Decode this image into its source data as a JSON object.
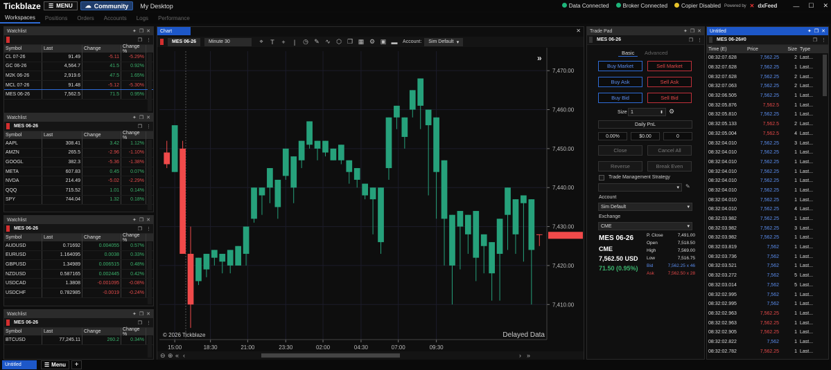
{
  "topbar": {
    "logo": "Tickblaze",
    "menu": "MENU",
    "community": "Community",
    "desktop": "My Desktop",
    "status": [
      {
        "label": "Data Connected",
        "color": "#1db57a"
      },
      {
        "label": "Broker Connected",
        "color": "#1db57a"
      },
      {
        "label": "Copier Disabled",
        "color": "#e6c229"
      }
    ],
    "powered_by": "Powered by",
    "feed": "dxFeed"
  },
  "workspace_tabs": [
    "Workspaces",
    "Positions",
    "Orders",
    "Accounts",
    "Logs",
    "Performance"
  ],
  "watchlists": [
    {
      "title": "Watchlist",
      "symbol": "",
      "headers": [
        "Symbol",
        "Last",
        "Change",
        "Change %"
      ],
      "rows": [
        [
          "CL 07-26",
          "91.49",
          "-5.11",
          "-5.29%"
        ],
        [
          "GC 06-26",
          "4,564.7",
          "41.5",
          "0.92%"
        ],
        [
          "M2K 06-26",
          "2,919.6",
          "47.5",
          "1.65%"
        ],
        [
          "MCL 07-26",
          "91.48",
          "-5.12",
          "-5.30%"
        ],
        [
          "MES 06-26",
          "7,562.5",
          "71.5",
          "0.95%"
        ]
      ]
    },
    {
      "title": "Watchlist",
      "symbol": "MES 06-26",
      "headers": [
        "Symbol",
        "Last",
        "Change",
        "Change %"
      ],
      "rows": [
        [
          "AAPL",
          "308.41",
          "3.42",
          "1.12%"
        ],
        [
          "AMZN",
          "265.5",
          "-2.96",
          "-1.10%"
        ],
        [
          "GOOGL",
          "382.3",
          "-5.36",
          "-1.38%"
        ],
        [
          "META",
          "607.83",
          "0.45",
          "0.07%"
        ],
        [
          "NVDA",
          "214.49",
          "-5.02",
          "-2.29%"
        ],
        [
          "QQQ",
          "715.52",
          "1.01",
          "0.14%"
        ],
        [
          "SPY",
          "744.04",
          "1.32",
          "0.18%"
        ]
      ]
    },
    {
      "title": "Watchlist",
      "symbol": "MES 06-26",
      "headers": [
        "Symbol",
        "Last",
        "Change",
        "Change %"
      ],
      "rows": [
        [
          "AUDUSD",
          "0.71692",
          "0.004055",
          "0.57%"
        ],
        [
          "EURUSD",
          "1.164095",
          "0.0038",
          "0.33%"
        ],
        [
          "GBPUSD",
          "1.34989",
          "0.006515",
          "0.48%"
        ],
        [
          "NZDUSD",
          "0.587165",
          "0.002445",
          "0.42%"
        ],
        [
          "USDCAD",
          "1.3808",
          "-0.001095",
          "-0.08%"
        ],
        [
          "USDCHF",
          "0.782985",
          "-0.0019",
          "-0.24%"
        ]
      ]
    },
    {
      "title": "Watchlist",
      "symbol": "MES 06-26",
      "headers": [
        "Symbol",
        "Last",
        "Change",
        "Change %"
      ],
      "rows": [
        [
          "BTCUSD",
          "77,245.11",
          "260.2",
          "0.34%"
        ]
      ]
    }
  ],
  "chart": {
    "tab": "Chart",
    "symbol": "MES 06-26",
    "interval": "Minute 30",
    "account_label": "Account:",
    "account": "Sim Default",
    "copyright": "© 2026 Tickblaze",
    "delayed": "Delayed Data",
    "price_ticks": [
      "7,470.00",
      "7,460.00",
      "7,450.00",
      "7,440.00",
      "7,430.00",
      "7,420.00",
      "7,410.00"
    ],
    "time_ticks": [
      "15:00",
      "18:30",
      "21:00",
      "23:30",
      "02:00",
      "04:30",
      "07:00",
      "09:30"
    ],
    "last_price": "7,427.75"
  },
  "chart_data": {
    "type": "candlestick",
    "ylim": [
      7401,
      7475
    ],
    "candles": [
      [
        7449,
        7452,
        7446,
        7445
      ],
      [
        7444,
        7449,
        7456,
        7444
      ],
      [
        7450,
        7452,
        7423,
        7450
      ],
      [
        7423,
        7430,
        7410,
        7404
      ],
      [
        7416,
        7416,
        7422,
        7415
      ],
      [
        7419,
        7419,
        7423,
        7417
      ],
      [
        7422,
        7422,
        7424,
        7420
      ],
      [
        7421,
        7421,
        7423,
        7418
      ],
      [
        7420,
        7419,
        7424,
        7418
      ],
      [
        7420,
        7420,
        7425,
        7420
      ],
      [
        7423,
        7422,
        7430,
        7420
      ],
      [
        7432,
        7432,
        7440,
        7431
      ],
      [
        7438,
        7438,
        7440,
        7433
      ],
      [
        7440,
        7440,
        7445,
        7436
      ],
      [
        7435,
        7435,
        7442,
        7432
      ],
      [
        7443,
        7443,
        7450,
        7442
      ],
      [
        7440,
        7440,
        7448,
        7436
      ],
      [
        7447,
        7447,
        7452,
        7445
      ],
      [
        7451,
        7451,
        7457,
        7450
      ],
      [
        7450,
        7450,
        7452,
        7447
      ],
      [
        7449,
        7449,
        7452,
        7448
      ],
      [
        7447,
        7447,
        7450,
        7447
      ],
      [
        7447,
        7447,
        7451,
        7446
      ],
      [
        7444,
        7444,
        7447,
        7441
      ],
      [
        7442,
        7442,
        7445,
        7440
      ],
      [
        7438,
        7438,
        7441,
        7437
      ],
      [
        7437,
        7437,
        7440,
        7428
      ],
      [
        7426,
        7426,
        7440,
        7423
      ],
      [
        7445,
        7445,
        7458,
        7442
      ],
      [
        7458,
        7458,
        7461,
        7455
      ],
      [
        7453,
        7452,
        7458,
        7450
      ],
      [
        7460,
        7460,
        7465,
        7458
      ],
      [
        7461,
        7461,
        7468,
        7455
      ],
      [
        7456,
        7456,
        7460,
        7438
      ],
      [
        7444,
        7444,
        7458,
        7432
      ],
      [
        7432,
        7432,
        7447,
        7420
      ],
      [
        7420,
        7420,
        7433,
        7410
      ],
      [
        7430,
        7430,
        7434,
        7419
      ],
      [
        7428,
        7428,
        7433,
        7423
      ],
      [
        7422,
        7422,
        7434,
        7416
      ],
      [
        7425,
        7425,
        7428,
        7418
      ],
      [
        7418,
        7418,
        7426,
        7411
      ],
      [
        7423,
        7423,
        7432,
        7411
      ],
      [
        7433,
        7433,
        7440,
        7424
      ],
      [
        7428,
        7428,
        7437,
        7423
      ],
      [
        7436,
        7436,
        7438,
        7421
      ],
      [
        7424,
        7424,
        7437,
        7410
      ],
      [
        7428,
        7428,
        7428,
        7425
      ]
    ]
  },
  "tradepad": {
    "title": "Trade Pad",
    "symbol": "MES 06-26",
    "tab_basic": "Basic",
    "tab_advanced": "Advanced",
    "buy_market": "Buy Market",
    "sell_market": "Sell Market",
    "buy_ask": "Buy Ask",
    "sell_ask": "Sell Ask",
    "buy_bid": "Buy Bid",
    "sell_bid": "Sell Bid",
    "size_label": "Size",
    "size": "1",
    "daily_pnl": "Daily PnL",
    "pnl_pct": "0.00%",
    "pnl_usd": "$0.00",
    "pnl_qty": "0",
    "close": "Close",
    "cancel_all": "Cancel All",
    "reverse": "Reverse",
    "break_even": "Break Even",
    "tms_label": "Trade Management Strategy",
    "account_label": "Account",
    "account": "Sim Default",
    "exchange_label": "Exchange",
    "exchange": "CME",
    "quote_symbol": "MES 06-26",
    "quote_exchange": "CME",
    "quote_price": "7,562.50 USD",
    "quote_change": "71.50 (0.95%)",
    "stats": [
      {
        "k": "P. Close",
        "v": "7,491.00",
        "color": "#ddd"
      },
      {
        "k": "Open",
        "v": "7,518.50",
        "color": "#ddd"
      },
      {
        "k": "High",
        "v": "7,569.00",
        "color": "#ddd"
      },
      {
        "k": "Low",
        "v": "7,516.75",
        "color": "#ddd"
      },
      {
        "k": "Bid",
        "v": "7,562.25 x 46",
        "color": "#5b8ef0"
      },
      {
        "k": "Ask",
        "v": "7,562.50 x 28",
        "color": "#e64949"
      }
    ]
  },
  "ts": {
    "title": "Untitled",
    "symbol": "MES 06-26#0",
    "headers": [
      "Time (E)",
      "Price",
      "Size",
      "Type"
    ],
    "rows": [
      [
        "08:32:07.628",
        "7,562.25",
        "2",
        "Last...",
        "b"
      ],
      [
        "08:32:07.628",
        "7,562.25",
        "1",
        "Last...",
        "b"
      ],
      [
        "08:32:07.628",
        "7,562.25",
        "2",
        "Last...",
        "b"
      ],
      [
        "08:32:07.063",
        "7,562.25",
        "2",
        "Last...",
        "b"
      ],
      [
        "08:32:06.505",
        "7,562.25",
        "1",
        "Last...",
        "b"
      ],
      [
        "08:32:05.876",
        "7,562.5",
        "1",
        "Last...",
        "r"
      ],
      [
        "08:32:05.810",
        "7,562.25",
        "1",
        "Last...",
        "b"
      ],
      [
        "08:32:05.133",
        "7,562.5",
        "2",
        "Last...",
        "r"
      ],
      [
        "08:32:05.004",
        "7,562.5",
        "4",
        "Last...",
        "r"
      ],
      [
        "08:32:04.010",
        "7,562.25",
        "3",
        "Last...",
        "b"
      ],
      [
        "08:32:04.010",
        "7,562.25",
        "1",
        "Last...",
        "b"
      ],
      [
        "08:32:04.010",
        "7,562.25",
        "1",
        "Last...",
        "b"
      ],
      [
        "08:32:04.010",
        "7,562.25",
        "1",
        "Last...",
        "b"
      ],
      [
        "08:32:04.010",
        "7,562.25",
        "1",
        "Last...",
        "b"
      ],
      [
        "08:32:04.010",
        "7,562.25",
        "1",
        "Last...",
        "b"
      ],
      [
        "08:32:04.010",
        "7,562.25",
        "1",
        "Last...",
        "b"
      ],
      [
        "08:32:04.010",
        "7,562.25",
        "4",
        "Last...",
        "b"
      ],
      [
        "08:32:03.982",
        "7,562.25",
        "1",
        "Last...",
        "b"
      ],
      [
        "08:32:03.982",
        "7,562.25",
        "3",
        "Last...",
        "b"
      ],
      [
        "08:32:03.982",
        "7,562.25",
        "1",
        "Last...",
        "b"
      ],
      [
        "08:32:03.819",
        "7,562",
        "1",
        "Last...",
        "b"
      ],
      [
        "08:32:03.736",
        "7,562",
        "1",
        "Last...",
        "b"
      ],
      [
        "08:32:03.521",
        "7,562",
        "1",
        "Last...",
        "b"
      ],
      [
        "08:32:03.272",
        "7,562",
        "5",
        "Last...",
        "b"
      ],
      [
        "08:32:03.014",
        "7,562",
        "5",
        "Last...",
        "b"
      ],
      [
        "08:32:02.995",
        "7,562",
        "1",
        "Last...",
        "b"
      ],
      [
        "08:32:02.995",
        "7,562",
        "1",
        "Last...",
        "b"
      ],
      [
        "08:32:02.963",
        "7,562.25",
        "1",
        "Last...",
        "r"
      ],
      [
        "08:32:02.963",
        "7,562.25",
        "1",
        "Last...",
        "r"
      ],
      [
        "08:32:02.905",
        "7,562.25",
        "1",
        "Last...",
        "r"
      ],
      [
        "08:32:02.822",
        "7,562",
        "1",
        "Last...",
        "b"
      ],
      [
        "08:32:02.782",
        "7,562.25",
        "1",
        "Last...",
        "r"
      ]
    ]
  },
  "bottombar": {
    "untitled": "Untitled",
    "menu": "Menu",
    "add": "+"
  }
}
